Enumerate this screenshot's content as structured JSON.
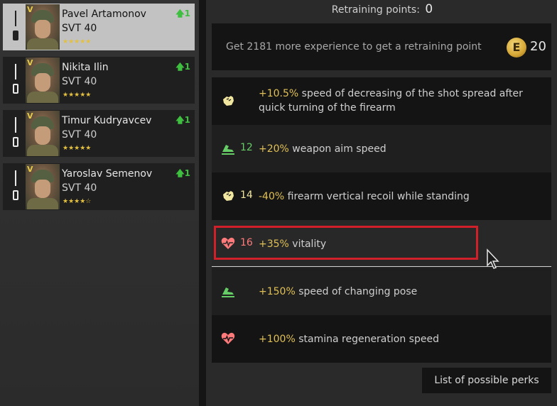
{
  "soldiers": [
    {
      "rank": "V",
      "name": "Pavel Artamonov",
      "weapon": "SVT 40",
      "stars": "★★★★★",
      "upgrade": "1",
      "selected": true
    },
    {
      "rank": "V",
      "name": "Nikita Ilin",
      "weapon": "SVT 40",
      "stars": "★★★★★",
      "upgrade": "1"
    },
    {
      "rank": "V",
      "name": "Timur Kudryavcev",
      "weapon": "SVT 40",
      "stars": "★★★★★",
      "upgrade": "1"
    },
    {
      "rank": "V",
      "name": "Yaroslav Semenov",
      "weapon": "SVT 40",
      "stars": "★★★★☆",
      "upgrade": "1"
    }
  ],
  "retraining": {
    "label": "Retraining points:",
    "value": "0"
  },
  "experience": {
    "message": "Get 2181 more experience to get a retraining point",
    "coin_glyph": "E",
    "amount": "20"
  },
  "perks": [
    {
      "icon": "fist-icon",
      "level": "",
      "bonus": "+10.5%",
      "text": " speed of decreasing of the shot spread after quick turning of the firearm"
    },
    {
      "icon": "boot-icon",
      "level": "12",
      "bonus": "+20%",
      "text": " weapon aim speed"
    },
    {
      "icon": "fist-icon",
      "level": "14",
      "bonus": "-40%",
      "text": " firearm vertical recoil while standing"
    },
    {
      "icon": "heart-icon",
      "level": "16",
      "bonus": "+35%",
      "text": " vitality"
    },
    {
      "icon": "boot-icon",
      "level": "",
      "bonus": "+150%",
      "text": " speed of changing pose"
    },
    {
      "icon": "heart-icon",
      "level": "",
      "bonus": "+100%",
      "text": " stamina regeneration speed"
    }
  ],
  "list_button": "List of possible perks",
  "colors": {
    "bonus": "#e0c055",
    "upgrade": "#3fbf3f",
    "fist_icon": "#f0e6a0",
    "boot_icon": "#66cc66",
    "heart_icon": "#ff7a7a",
    "highlight": "#d2202a"
  }
}
